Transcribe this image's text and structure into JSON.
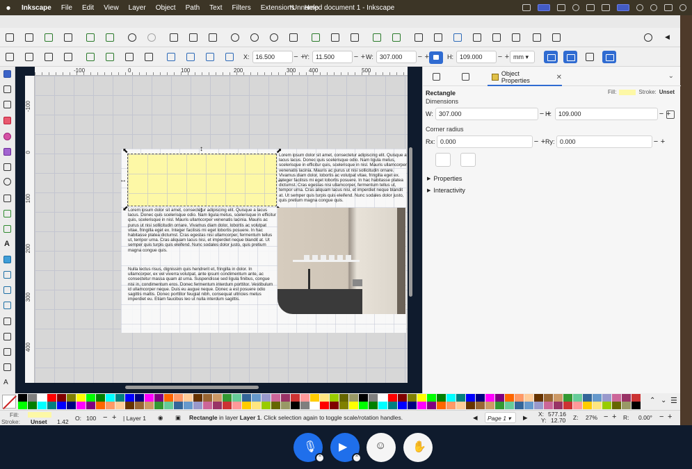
{
  "menubar": {
    "apple": "",
    "app": "Inkscape",
    "items": [
      "File",
      "Edit",
      "View",
      "Layer",
      "Object",
      "Path",
      "Text",
      "Filters",
      "Extensions",
      "Help"
    ],
    "window_title": "*Unnamed document 1 - Inkscape"
  },
  "toolbar2": {
    "x_label": "X:",
    "x_value": "16.500",
    "y_label": "Y:",
    "y_value": "11.500",
    "w_label": "W:",
    "w_value": "307.000",
    "h_label": "H:",
    "h_value": "109.000",
    "unit": "mm"
  },
  "rulers": {
    "h_ticks": [
      "-100",
      "0",
      "100",
      "200",
      "300",
      "400",
      "500"
    ],
    "v_ticks": [
      "-100",
      "0",
      "100",
      "200",
      "300",
      "400"
    ]
  },
  "canvas": {
    "text_right": "Lorem ipsum dolor sit amet, consectetur adipiscing elit. Quisque a lacus lacus. Donec quis scelerisque odio. Nam ligula metus, scelerisque in efficitur quis, scelerisque in nisl. Mauris ullamcorper venenatis lacinia. Mauris ac purus ut nisi sollicitudin ornare. Vivamus diam dolor, lobortis ac volutpat vitae, fringilla eget ex. Integer facilisis mi eget lobortis posuere. In hac habitasse platea dictumst. Cras egestas nisi ullamcorper, fermentum tellus ut, tempor urna. Cras aliquam lacus nisi, et imperdiet neque blandit at. Ut semper quis turpis quis eleifend. Nunc sodales dolor justo, quis pretium magna congue quis.",
    "text_left_p1": "Lorem ipsum dolor sit amet, consectetur adipiscing elit. Quisque a lacus lacus. Donec quis scelerisque odio. Nam ligula metus, scelerisque in efficitur quis, scelerisque in nisl. Mauris ullamcorper venenatis lacinia. Mauris ac purus ut nisi sollicitudin ornare. Vivamus diam dolor, lobortis ac volutpat vitae, fringilla eget ex. Integer facilisis mi eget lobortis posuere. In hac habitasse platea dictumst. Cras egestas nisi ullamcorper, fermentum tellus ut, tempor urna. Cras aliquam lacus nisi, et imperdiet neque blandit at. Ut semper quis turpis quis eleifend. Nunc sodales dolor justo, quis pretium magna congue quis.",
    "text_left_p2": "Nulla lectus risus, dignissim quis hendrerit et, fringilla in dolor. In ullamcorper, ex vel viverra volutpat, ante ipsum condimentum ante, ac consectetur massa quam at urna. Suspendisse sed ligula finibus, congue nisi in, condimentum eros. Donec fermentum interdum porttitor. Vestibulum id ullamcorper neque. Duis eu augue neque. Donec a est posuere odio sagittis mattis. Donec porttitor feugiat nibh, consequat ultricies metus imperdiet eu. Etiam faucibus leo ut nulla interdum sagittis."
  },
  "panel": {
    "tab_label": "Object Properties",
    "object_type": "Rectangle",
    "fill_label": "Fill:",
    "stroke_label": "Stroke:",
    "stroke_value": "Unset",
    "dimensions_label": "Dimensions",
    "w_label": "W:",
    "w_value": "307.000",
    "h_label": "H:",
    "h_value": "109.000",
    "corner_label": "Corner radius",
    "rx_label": "Rx:",
    "rx_value": "0.000",
    "ry_label": "Ry:",
    "ry_value": "0.000",
    "properties_label": "Properties",
    "interactivity_label": "Interactivity"
  },
  "palette": {
    "swatches": [
      "#000000",
      "#7f7f7f",
      "#ffffff",
      "#ff0000",
      "#800000",
      "#808000",
      "#ffff00",
      "#00ff00",
      "#008000",
      "#00ffff",
      "#008080",
      "#0000ff",
      "#000080",
      "#ff00ff",
      "#800080"
    ]
  },
  "status": {
    "fill_label": "Fill:",
    "stroke_label": "Stroke:",
    "stroke_value": "Unset",
    "stroke_width": "1.42",
    "opacity_label": "O:",
    "opacity_value": "100",
    "layer_name": "Layer 1",
    "message_bold": "Rectangle",
    "message_rest": " in layer ",
    "message_layer": "Layer 1",
    "message_tail": ". Click selection again to toggle scale/rotation handles.",
    "page": "Page 1",
    "x_label": "X:",
    "x_value": "577.16",
    "y_label": "Y:",
    "y_value": "12.70",
    "zoom_label": "Z:",
    "zoom_value": "27%",
    "rotation_label": "R:",
    "rotation_value": "0.00°"
  },
  "colors": {
    "fill": "#fdf8a6",
    "accent": "#2f6bd1",
    "meeting_blue": "#1f6feb"
  },
  "meeting_bar": {
    "buttons": [
      "microphone-icon",
      "video-camera-icon",
      "emoji-reaction-icon",
      "raise-hand-icon"
    ]
  }
}
